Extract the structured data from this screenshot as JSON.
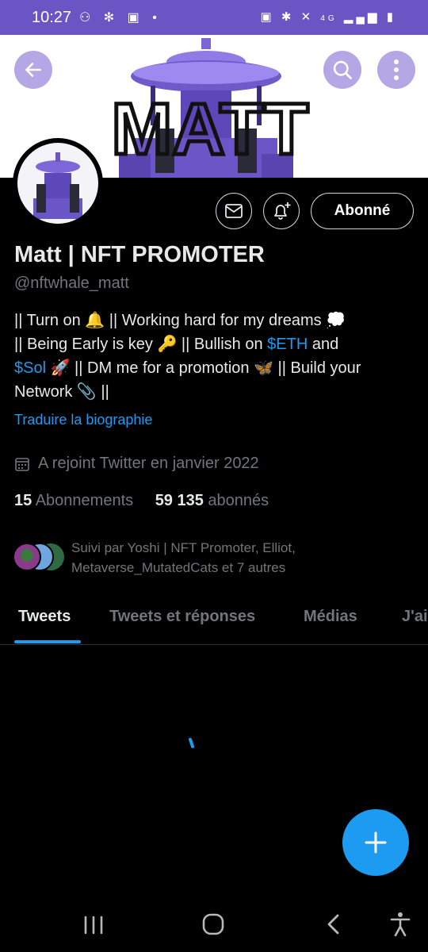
{
  "status_bar": {
    "time": "10:27",
    "network": "4G"
  },
  "banner": {
    "text": "MATT"
  },
  "profile": {
    "name": "Matt | NFT PROMOTER",
    "handle": "@nftwhale_matt",
    "follow_button": "Abonné",
    "bio": {
      "line1_a": "|| Turn on ",
      "line1_b": " || Working hard for my dreams ",
      "line2_a": "|| Being Early is key ",
      "line2_b": " || Bullish on ",
      "line2_eth": "$ETH",
      "line2_c": " and",
      "line3_sol": "$Sol",
      "line3_b": " || DM me for a promotion ",
      "line3_c": " || Build your",
      "line4": "Network ",
      "line4_b": " ||"
    },
    "translate_link": "Traduire la biographie",
    "joined": "A rejoint Twitter en janvier 2022",
    "following_count": "15",
    "following_label": "Abonnements",
    "followers_count": "59 135",
    "followers_label": "abonnés",
    "followed_by": "Suivi par Yoshi | NFT Promoter, Elliot, Metaverse_MutatedCats et 7 autres"
  },
  "tabs": [
    "Tweets",
    "Tweets et réponses",
    "Médias",
    "J'ai"
  ],
  "colors": {
    "accent": "#1d9bf0",
    "banner_purple": "#6a55c4"
  }
}
